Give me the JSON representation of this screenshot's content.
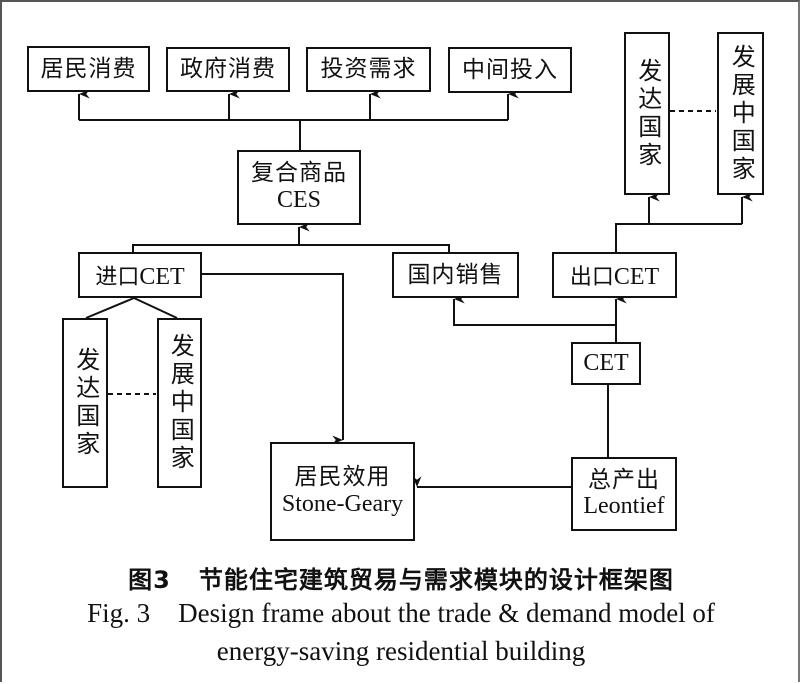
{
  "diagram": {
    "final_demand": [
      {
        "label": "居民消费"
      },
      {
        "label": "政府消费"
      },
      {
        "label": "投资需求"
      },
      {
        "label": "中间投入"
      }
    ],
    "composite_goods": {
      "label_zh": "复合商品",
      "label_en": "CES"
    },
    "imports": {
      "label_zh": "进口",
      "label_en": "CET"
    },
    "domestic_sales": {
      "label": "国内销售"
    },
    "exports": {
      "label_zh": "出口",
      "label_en": "CET"
    },
    "import_sources": [
      {
        "label": "发达国家"
      },
      {
        "label": "发展中国家"
      }
    ],
    "export_destinations": [
      {
        "label": "发达国家"
      },
      {
        "label": "发展中国家"
      }
    ],
    "cet": {
      "label": "CET"
    },
    "total_output": {
      "label_zh": "总产出",
      "label_en": "Leontief"
    },
    "household_utility": {
      "label_zh": "居民效用",
      "label_en": "Stone-Geary"
    }
  },
  "caption": {
    "zh_number": "图3",
    "zh_title": "节能住宅建筑贸易与需求模块的设计框架图",
    "en_number": "Fig. 3",
    "en_title_line1": "Design frame about the trade & demand model of",
    "en_title_line2": "energy-saving residential building"
  }
}
